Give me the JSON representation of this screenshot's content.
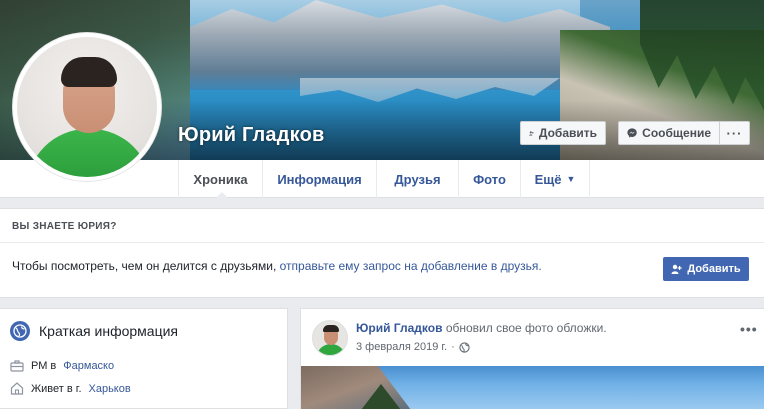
{
  "profile": {
    "name": "Юрий Гладков",
    "add_friend_label": "Добавить",
    "message_label": "Сообщение",
    "more_label": "···"
  },
  "tabs": [
    {
      "label": "Хроника",
      "active": true
    },
    {
      "label": "Информация"
    },
    {
      "label": "Друзья"
    },
    {
      "label": "Фото"
    },
    {
      "label": "Ещё",
      "caret": "▼"
    }
  ],
  "know_panel": {
    "title": "ВЫ ЗНАЕТЕ ЮРИЯ?",
    "text_before": "Чтобы посмотреть, чем он делится с друзьями,",
    "text_link": "отправьте ему запрос на добавление в друзья.",
    "button_label": "Добавить"
  },
  "intro": {
    "title": "Краткая информация",
    "rows": [
      {
        "prefix": "РМ в",
        "link": "Фармаско",
        "icon": "briefcase-icon"
      },
      {
        "prefix": "Живет в г.",
        "link": "Харьков",
        "icon": "home-icon"
      }
    ]
  },
  "post": {
    "author": "Юрий Гладков",
    "action": "обновил свое фото обложки.",
    "date": "3 февраля 2019 г.",
    "sep": "·",
    "dots": "•••"
  },
  "colors": {
    "link": "#365899",
    "primary_button": "#4267b2",
    "background": "#e9ebee"
  }
}
